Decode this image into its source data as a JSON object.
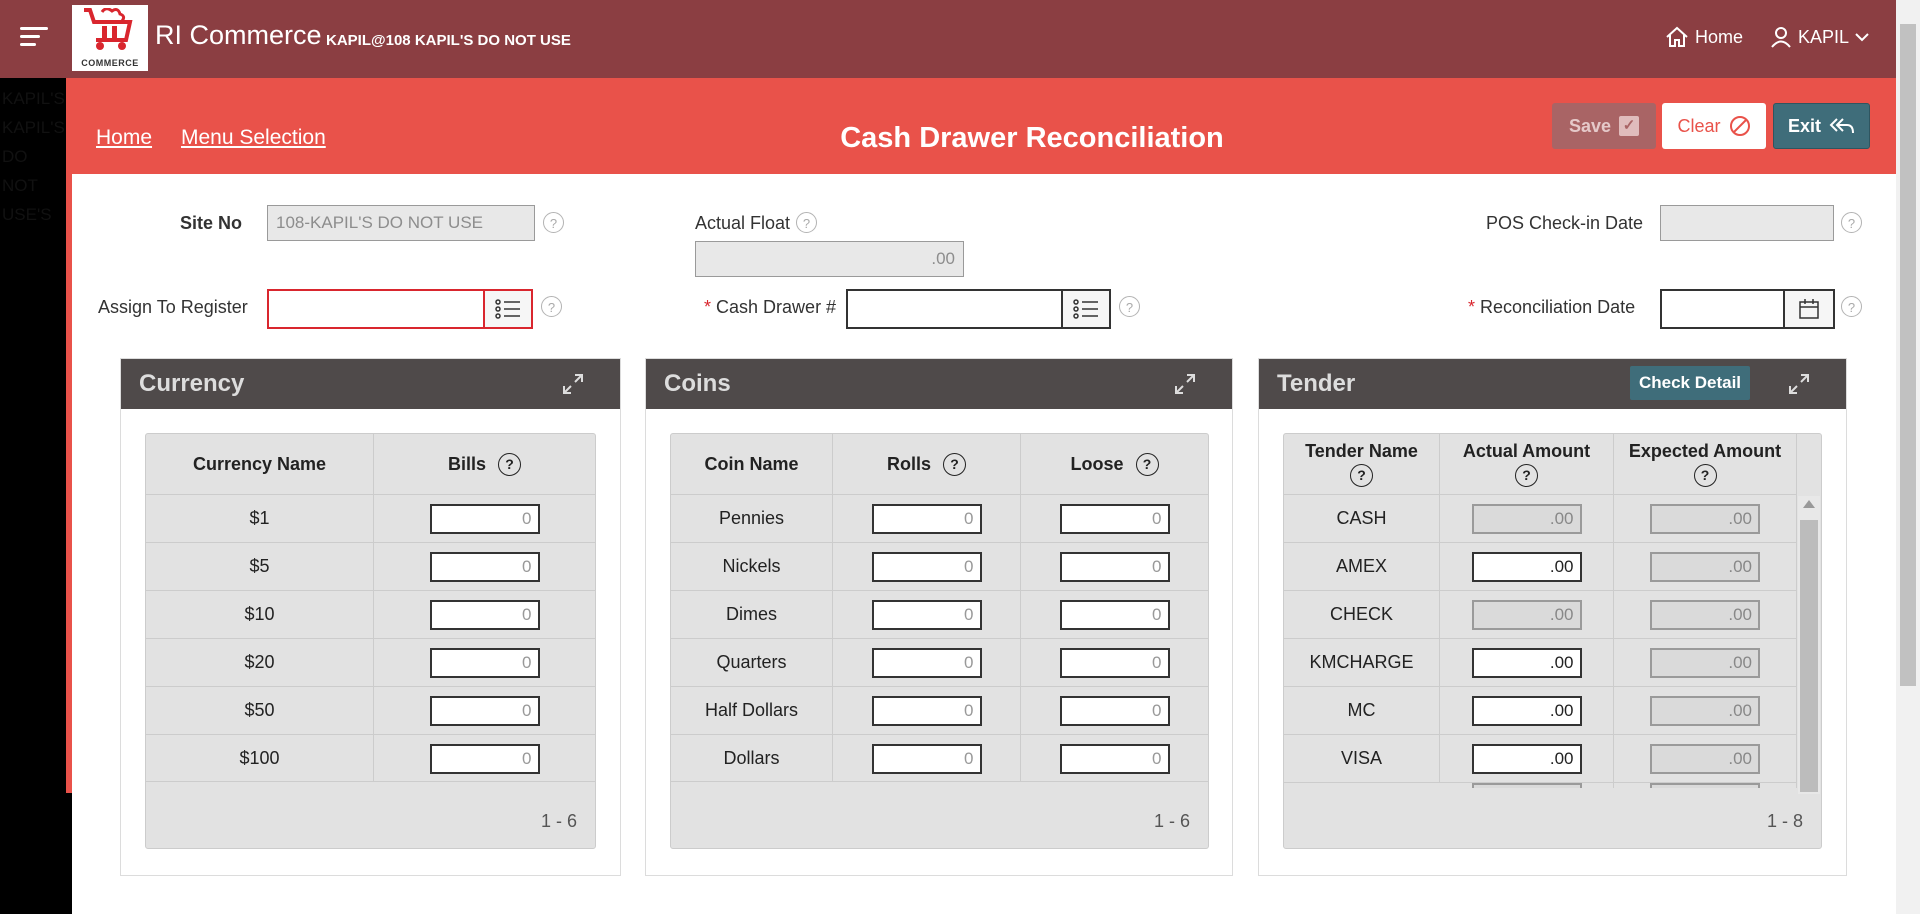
{
  "header": {
    "app_title": "RI Commerce",
    "app_subtitle": "KAPIL@108 KAPIL'S DO NOT USE",
    "logo_text": "COMMERCE",
    "home_label": "Home",
    "user_label": "KAPIL"
  },
  "side_text": "KAPIL'S KAPIL'S DO NOT USE'S",
  "subheader": {
    "home_link": "Home",
    "menu_link": "Menu Selection",
    "page_title": "Cash Drawer Reconciliation",
    "save_label": "Save",
    "clear_label": "Clear",
    "exit_label": "Exit"
  },
  "form": {
    "site_no_label": "Site No",
    "site_no_value": "108-KAPIL'S DO NOT USE",
    "actual_float_label": "Actual Float",
    "actual_float_value": ".00",
    "pos_checkin_label": "POS Check-in Date",
    "pos_checkin_value": "",
    "assign_register_label": "Assign To Register",
    "assign_register_value": "",
    "cash_drawer_label": "Cash Drawer #",
    "cash_drawer_value": "",
    "reconciliation_date_label": "Reconciliation Date",
    "reconciliation_date_value": "",
    "required_mark": "*",
    "help_glyph": "?"
  },
  "currency": {
    "title": "Currency",
    "col_name": "Currency Name",
    "col_bills": "Bills",
    "rows": [
      {
        "name": "$1",
        "bills": "0"
      },
      {
        "name": "$5",
        "bills": "0"
      },
      {
        "name": "$10",
        "bills": "0"
      },
      {
        "name": "$20",
        "bills": "0"
      },
      {
        "name": "$50",
        "bills": "0"
      },
      {
        "name": "$100",
        "bills": "0"
      }
    ],
    "pager": "1 - 6"
  },
  "coins": {
    "title": "Coins",
    "col_name": "Coin Name",
    "col_rolls": "Rolls",
    "col_loose": "Loose",
    "rows": [
      {
        "name": "Pennies",
        "rolls": "0",
        "loose": "0"
      },
      {
        "name": "Nickels",
        "rolls": "0",
        "loose": "0"
      },
      {
        "name": "Dimes",
        "rolls": "0",
        "loose": "0"
      },
      {
        "name": "Quarters",
        "rolls": "0",
        "loose": "0"
      },
      {
        "name": "Half Dollars",
        "rolls": "0",
        "loose": "0"
      },
      {
        "name": "Dollars",
        "rolls": "0",
        "loose": "0"
      }
    ],
    "pager": "1 - 6"
  },
  "tender": {
    "title": "Tender",
    "check_detail_label": "Check Detail",
    "col_name": "Tender Name",
    "col_actual": "Actual Amount",
    "col_expected": "Expected Amount",
    "rows": [
      {
        "name": "CASH",
        "actual": ".00",
        "expected": ".00"
      },
      {
        "name": "AMEX",
        "actual": ".00",
        "expected": ".00"
      },
      {
        "name": "CHECK",
        "actual": ".00",
        "expected": ".00"
      },
      {
        "name": "KMCHARGE",
        "actual": ".00",
        "expected": ".00"
      },
      {
        "name": "MC",
        "actual": ".00",
        "expected": ".00"
      },
      {
        "name": "VISA",
        "actual": ".00",
        "expected": ".00"
      }
    ],
    "pager": "1 - 8"
  },
  "colors": {
    "topbar": "#8b3e42",
    "subheader": "#e9524a",
    "panel_header": "#4f4a4a",
    "exit_button": "#3f6d7a"
  }
}
